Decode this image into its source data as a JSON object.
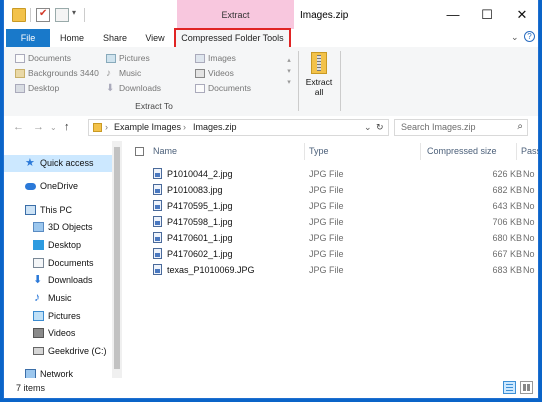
{
  "window": {
    "title": "Images.zip",
    "contextual_tab_group": "Extract",
    "controls": {
      "minimize": "—",
      "maximize": "☐",
      "close": "✕"
    }
  },
  "tabs": {
    "file": "File",
    "home": "Home",
    "share": "Share",
    "view": "View",
    "compressed": "Compressed Folder Tools"
  },
  "ribbon": {
    "destinations": [
      {
        "label": "Documents",
        "icon": "document-icon"
      },
      {
        "label": "Backgrounds 3440",
        "icon": "folder-icon"
      },
      {
        "label": "Desktop",
        "icon": "desktop-icon"
      },
      {
        "label": "Pictures",
        "icon": "pictures-icon"
      },
      {
        "label": "Music",
        "icon": "music-icon"
      },
      {
        "label": "Downloads",
        "icon": "downloads-icon"
      },
      {
        "label": "Images",
        "icon": "images-folder-icon"
      },
      {
        "label": "Videos",
        "icon": "videos-icon"
      },
      {
        "label": "Documents",
        "icon": "document-icon"
      }
    ],
    "group_label": "Extract To",
    "extract_all_line1": "Extract",
    "extract_all_line2": "all"
  },
  "address": {
    "crumbs": [
      "Example Images",
      "Images.zip"
    ],
    "search_placeholder": "Search Images.zip"
  },
  "nav": {
    "items": [
      {
        "label": "Quick access",
        "icon": "star-icon",
        "selected": true
      },
      {
        "label": "OneDrive",
        "icon": "cloud-icon"
      },
      {
        "label": "This PC",
        "icon": "computer-icon"
      },
      {
        "label": "3D Objects",
        "icon": "cube-icon"
      },
      {
        "label": "Desktop",
        "icon": "desktop-icon"
      },
      {
        "label": "Documents",
        "icon": "document-icon"
      },
      {
        "label": "Downloads",
        "icon": "downloads-icon"
      },
      {
        "label": "Music",
        "icon": "music-icon"
      },
      {
        "label": "Pictures",
        "icon": "pictures-icon"
      },
      {
        "label": "Videos",
        "icon": "videos-icon"
      },
      {
        "label": "Geekdrive (C:)",
        "icon": "drive-icon"
      },
      {
        "label": "Network",
        "icon": "network-icon"
      }
    ]
  },
  "table": {
    "columns": {
      "name": "Name",
      "type": "Type",
      "size": "Compressed size",
      "password": "Passw"
    },
    "rows": [
      {
        "name": "P1010044_2.jpg",
        "type": "JPG File",
        "size": "626 KB",
        "password": "No"
      },
      {
        "name": "P1010083.jpg",
        "type": "JPG File",
        "size": "682 KB",
        "password": "No"
      },
      {
        "name": "P4170595_1.jpg",
        "type": "JPG File",
        "size": "643 KB",
        "password": "No"
      },
      {
        "name": "P4170598_1.jpg",
        "type": "JPG File",
        "size": "706 KB",
        "password": "No"
      },
      {
        "name": "P4170601_1.jpg",
        "type": "JPG File",
        "size": "680 KB",
        "password": "No"
      },
      {
        "name": "P4170602_1.jpg",
        "type": "JPG File",
        "size": "667 KB",
        "password": "No"
      },
      {
        "name": "texas_P1010069.JPG",
        "type": "JPG File",
        "size": "683 KB",
        "password": "No"
      }
    ]
  },
  "status": {
    "count": "7 items"
  },
  "colors": {
    "accent": "#1979ca",
    "context_tab": "#f8c7de",
    "highlight_border": "#e02424",
    "selection": "#cce8ff"
  }
}
